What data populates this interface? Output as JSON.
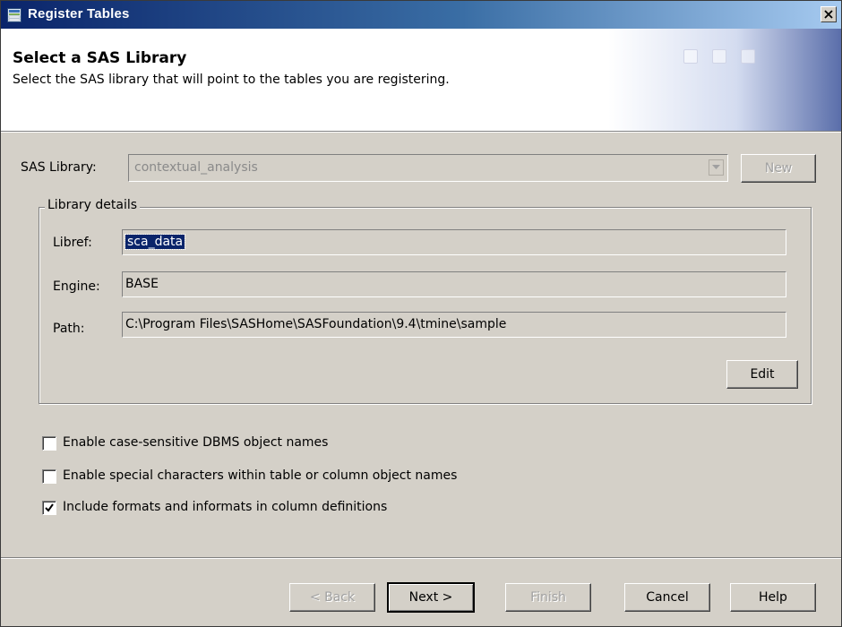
{
  "window": {
    "title": "Register Tables",
    "icon": "register-tables-icon",
    "close_icon": "close-icon"
  },
  "header": {
    "title": "Select a SAS Library",
    "subtitle": "Select the SAS library that will point to the tables you are registering."
  },
  "library": {
    "label": "SAS Library:",
    "value": "contextual_analysis",
    "new_button": "New"
  },
  "details": {
    "legend": "Library details",
    "libref_label": "Libref:",
    "libref_value": "sca_data",
    "engine_label": "Engine:",
    "engine_value": "BASE",
    "path_label": "Path:",
    "path_value": "C:\\Program Files\\SASHome\\SASFoundation\\9.4\\tmine\\sample",
    "edit_button": "Edit"
  },
  "options": [
    {
      "label": "Enable case-sensitive DBMS object names",
      "checked": false
    },
    {
      "label": "Enable special characters within table or column object names",
      "checked": false
    },
    {
      "label": "Include formats and informats in column definitions",
      "checked": true
    }
  ],
  "footer": {
    "back": "< Back",
    "next": "Next >",
    "finish": "Finish",
    "cancel": "Cancel",
    "help": "Help"
  }
}
